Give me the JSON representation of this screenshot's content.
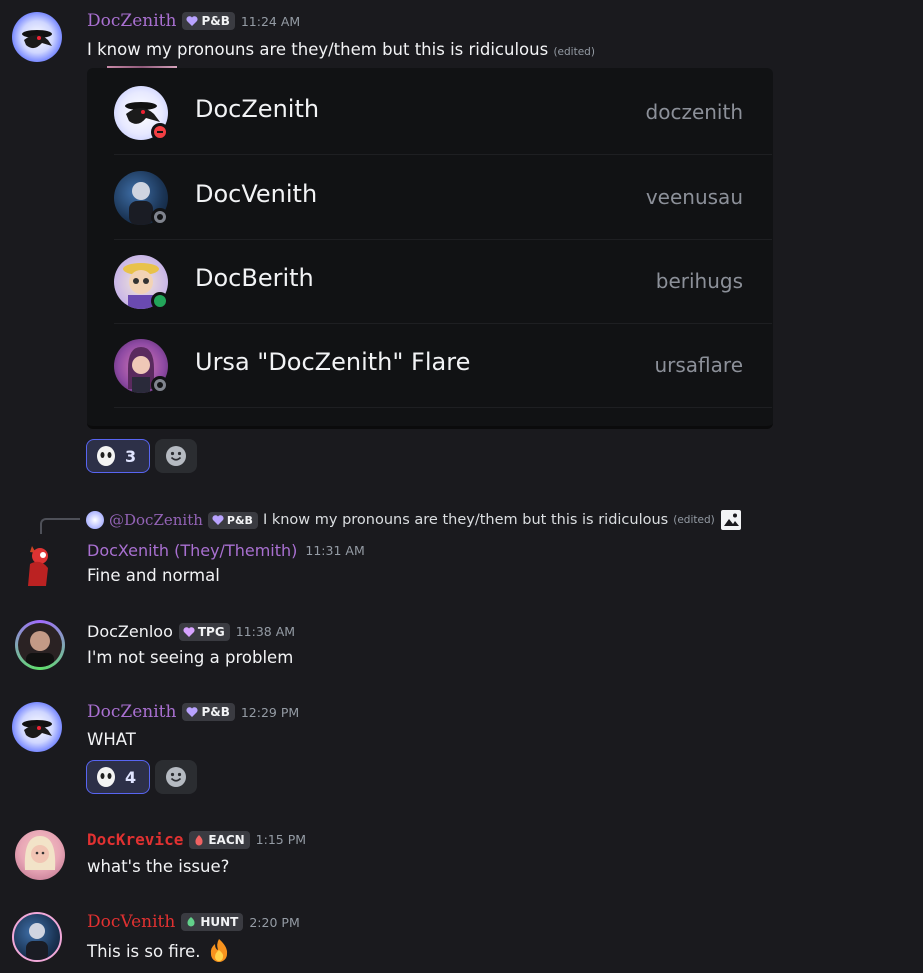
{
  "messages": {
    "m1": {
      "author": "DocZenith",
      "tag": "P&B",
      "time": "11:24 AM",
      "text": "I know my pronouns are they/them but this is ridiculous",
      "edited": "(edited)"
    },
    "embed": {
      "rows": [
        {
          "name": "DocZenith",
          "handle": "doczenith",
          "status": "dnd"
        },
        {
          "name": "DocVenith",
          "handle": "veenusau",
          "status": "offline"
        },
        {
          "name": "DocBerith",
          "handle": "berihugs",
          "status": "online"
        },
        {
          "name": "Ursa \"DocZenith\" Flare",
          "handle": "ursaflare",
          "status": "offline"
        }
      ]
    },
    "m1_reaction": {
      "count": "3"
    },
    "reply": {
      "mention": "@DocZenith",
      "tag": "P&B",
      "text": "I know my pronouns are they/them but this is ridiculous",
      "edited": "(edited)"
    },
    "m2": {
      "author": "DocXenith (They/Themith)",
      "time": "11:31 AM",
      "text": "Fine and normal"
    },
    "m3": {
      "author": "DocZenloo",
      "tag": "TPG",
      "time": "11:38 AM",
      "text": "I'm not seeing a problem"
    },
    "m4": {
      "author": "DocZenith",
      "tag": "P&B",
      "time": "12:29 PM",
      "text": "WHAT"
    },
    "m4_reaction": {
      "count": "4"
    },
    "m5": {
      "author": "DocKrevice",
      "tag": "EACN",
      "time": "1:15 PM",
      "text": "what's the issue?"
    },
    "m6": {
      "author": "DocVenith",
      "tag": "HUNT",
      "time": "2:20 PM",
      "text": "This is so fire.",
      "emoji": "fire-emoji"
    }
  },
  "colors": {
    "background": "#1a1a1e",
    "purple_name": "#a970d1",
    "red_name": "#e03131",
    "accent": "#5865f2"
  }
}
